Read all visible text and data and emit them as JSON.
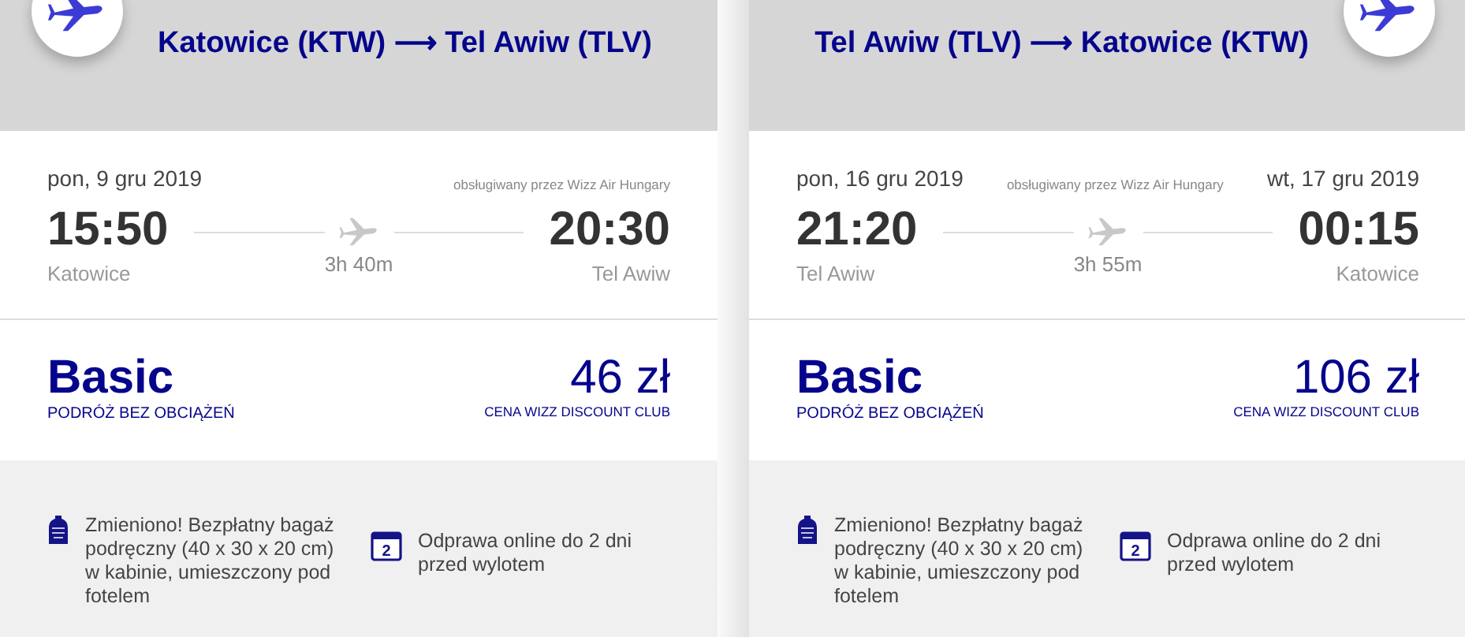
{
  "flights": [
    {
      "route": "Katowice (KTW) ⟶ Tel Awiw (TLV)",
      "departure_date": "pon, 9 gru 2019",
      "operator": "obsługiwany przez Wizz Air Hungary",
      "departure_time": "15:50",
      "duration": "3h 40m",
      "arrival_time": "20:30",
      "origin": "Katowice",
      "destination": "Tel Awiw",
      "fare": "Basic",
      "fare_subtitle": "PODRÓŻ BEZ OBCIĄŻEŃ",
      "price": "46 zł",
      "price_note": "CENA WIZZ DISCOUNT CLUB",
      "features": [
        {
          "kind": "bag",
          "text": "Zmieniono! Bezpłatny bagaż podręczny (40 x 30 x 20 cm) w kabinie, umieszczony pod fotelem"
        },
        {
          "kind": "calendar",
          "icon_text": "2",
          "text": "Odprawa online do 2 dni przed wylotem"
        }
      ]
    },
    {
      "route": "Tel Awiw (TLV) ⟶ Katowice (KTW)",
      "departure_date": "pon, 16 gru 2019",
      "operator": "obsługiwany przez Wizz Air Hungary",
      "arrival_date": "wt, 17 gru 2019",
      "departure_time": "21:20",
      "duration": "3h 55m",
      "arrival_time": "00:15",
      "origin": "Tel Awiw",
      "destination": "Katowice",
      "fare": "Basic",
      "fare_subtitle": "PODRÓŻ BEZ OBCIĄŻEŃ",
      "price": "106 zł",
      "price_note": "CENA WIZZ DISCOUNT CLUB",
      "features": [
        {
          "kind": "bag",
          "text": "Zmieniono! Bezpłatny bagaż podręczny (40 x 30 x 20 cm) w kabinie, umieszczony pod fotelem"
        },
        {
          "kind": "calendar",
          "icon_text": "2",
          "text": "Odprawa online do 2 dni przed wylotem"
        }
      ]
    }
  ]
}
